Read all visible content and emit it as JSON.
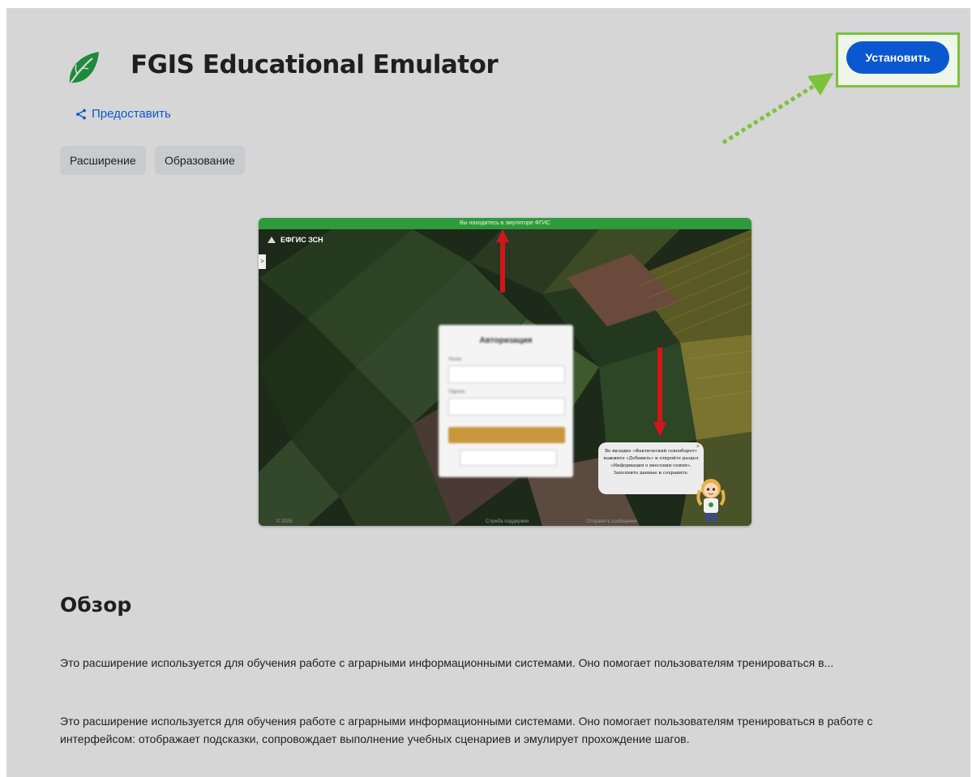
{
  "header": {
    "app_title": "FGIS Educational Emulator",
    "install_label": "Установить",
    "share_label": "Предоставить",
    "leaf_icon": "leaf-icon",
    "share_icon": "share-icon"
  },
  "chips": [
    "Расширение",
    "Образование"
  ],
  "preview": {
    "banner": "Вы находитесь в эмуляторе ФГИС",
    "logo_text": "ЕФГИС ЗСН",
    "side_toggle": ">",
    "login_title": "Авторизация",
    "login_label": "Логин",
    "password_label": "Пароль",
    "tip_text": "Во вкладке «Фактический севооборот» нажмите «Добавить» и откройте раздел «Информация о внесении семян». Заполните данные и сохраните.",
    "tip_close": "×",
    "footer_left": "© 2025",
    "footer_mid": "Служба поддержки",
    "footer_right": "Отправить сообщение"
  },
  "overview": {
    "heading": "Обзор",
    "summary": "Это расширение используется для обучения работе с аграрными информационными системами. Оно помогает пользователям тренироваться в...",
    "description": "Это расширение используется для обучения работе с аграрными информационными системами. Оно помогает пользователям тренироваться в работе с интерфейсом: отображает подсказки, сопровождает выполнение учебных сценариев и эмулирует прохождение шагов."
  },
  "colors": {
    "page_bg": "#d6d6d6",
    "accent_blue": "#0b57d0",
    "leaf_green": "#1e8a3a",
    "highlight_green": "#7cc23c",
    "banner_green": "#2f9a3a",
    "arrow_red": "#d0161b"
  }
}
